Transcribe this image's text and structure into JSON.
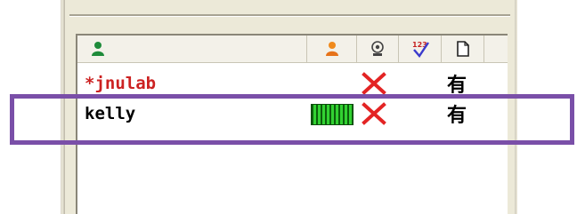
{
  "columns": [
    {
      "icon": "user-green-icon"
    },
    {
      "icon": "user-orange-icon"
    },
    {
      "icon": "webcam-icon"
    },
    {
      "icon": "number-check-icon",
      "label": "123"
    },
    {
      "icon": "file-icon"
    }
  ],
  "contacts": [
    {
      "name": "*jnulab",
      "status": "x",
      "extra": "有"
    },
    {
      "name": "kelly",
      "status": "x",
      "extra": "有",
      "meter": true
    }
  ],
  "colors": {
    "highlight": "#7a4fa8",
    "name_active": "#cc2222",
    "x_mark": "#e32424",
    "meter": "#16a016"
  }
}
